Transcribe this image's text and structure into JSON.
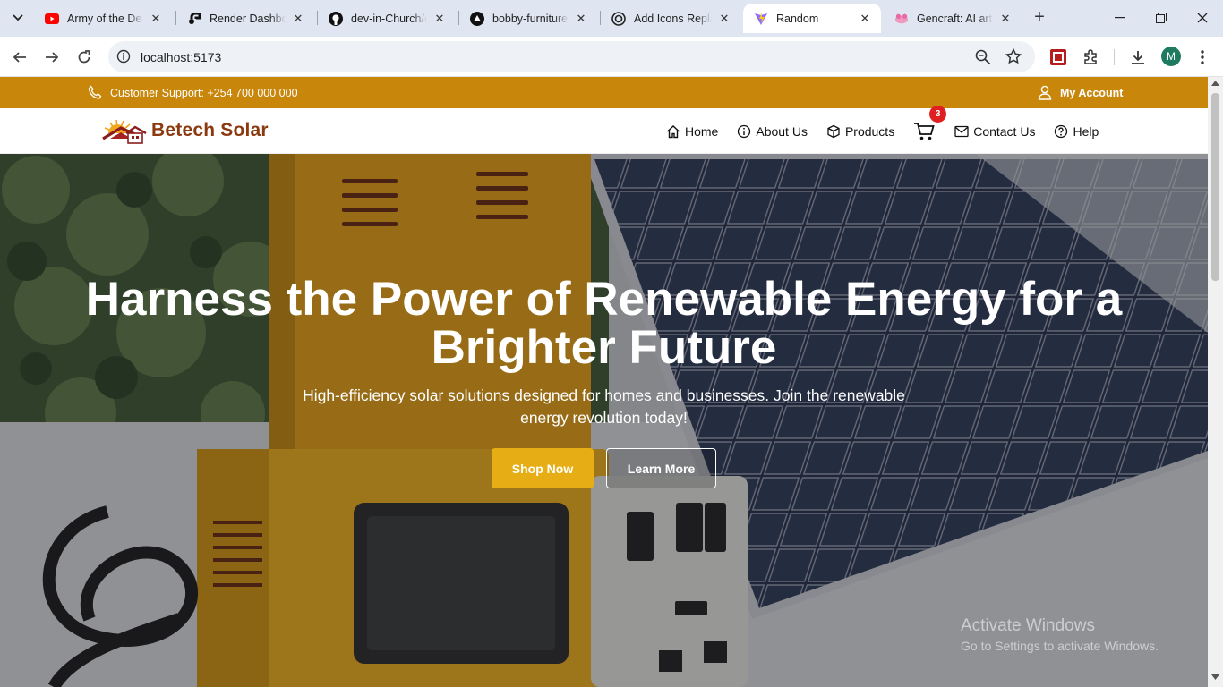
{
  "browser": {
    "tabs": [
      {
        "title": "Army of the Dead",
        "icon": "youtube-icon"
      },
      {
        "title": "Render Dashboard",
        "icon": "render-icon"
      },
      {
        "title": "dev-in-Church/c",
        "icon": "github-icon"
      },
      {
        "title": "bobby-furniture",
        "icon": "vercel-icon"
      },
      {
        "title": "Add Icons Replace",
        "icon": "openai-icon"
      },
      {
        "title": "Random",
        "icon": "vite-icon"
      },
      {
        "title": "Gencraft: AI art g",
        "icon": "gencraft-icon"
      }
    ],
    "active_tab_index": 5,
    "url": "localhost:5173",
    "profile_initial": "M"
  },
  "topbar": {
    "support_text": "Customer Support: +254 700 000 000",
    "account_label": "My Account"
  },
  "navbar": {
    "brand": "Betech Solar",
    "links": [
      {
        "label": "Home",
        "icon": "home-icon"
      },
      {
        "label": "About Us",
        "icon": "info-icon"
      },
      {
        "label": "Products",
        "icon": "box-icon"
      },
      {
        "label": "Contact Us",
        "icon": "mail-icon"
      },
      {
        "label": "Help",
        "icon": "help-icon"
      }
    ],
    "cart_count": "3"
  },
  "hero": {
    "title_line1": "Harness the Power of Renewable Energy for a",
    "title_line2": "Brighter Future",
    "subtitle": "High-efficiency solar solutions designed for homes and businesses. Join the renewable energy revolution today!",
    "shop_button": "Shop Now",
    "learn_button": "Learn More"
  },
  "watermark": {
    "line1": "Activate Windows",
    "line2": "Go to Settings to activate Windows."
  },
  "colors": {
    "topbar": "#c8860b",
    "brand": "#8b3a10",
    "shop_button": "#e6ad14",
    "cart_badge": "#e02020"
  }
}
